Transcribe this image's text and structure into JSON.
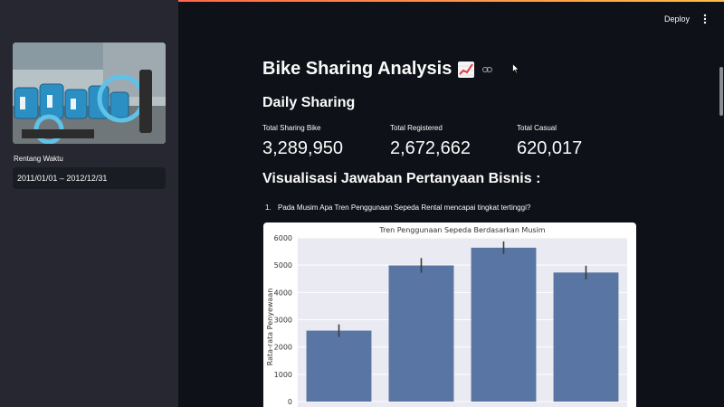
{
  "header": {
    "deploy_label": "Deploy",
    "menu_icon": "more-vertical-icon"
  },
  "sidebar": {
    "image_alt_icon": "bike-share-photo",
    "date_label": "Rentang Waktu",
    "date_range_value": "2011/01/01 – 2012/12/31"
  },
  "main": {
    "title": "Bike Sharing Analysis",
    "title_icon": "chart-increasing-emoji",
    "anchor_icon": "link-icon",
    "daily_heading": "Daily Sharing",
    "metrics": [
      {
        "label": "Total Sharing Bike",
        "value": "3,289,950"
      },
      {
        "label": "Total Registered",
        "value": "2,672,662"
      },
      {
        "label": "Total Casual",
        "value": "620,017"
      }
    ],
    "viz_heading": "Visualisasi Jawaban Pertanyaan Bisnis :",
    "questions": [
      {
        "number": "1.",
        "text": "Pada Musim Apa Tren Penggunaan Sepeda Rental mencapai tingkat tertinggi?"
      }
    ]
  },
  "colors": {
    "app_bg": "#0e1117",
    "sidebar_bg": "#262730",
    "bar": "#5875a4",
    "plot_bg": "#eaeaf2"
  },
  "chart_data": {
    "type": "bar",
    "title": "Tren Penggunaan Sepeda Berdasarkan Musim",
    "xlabel": "",
    "ylabel": "Rata-rata Penyewaan",
    "ylim": [
      0,
      6000
    ],
    "yticks": [
      0,
      1000,
      2000,
      3000,
      4000,
      5000,
      6000
    ],
    "values": [
      2600,
      4990,
      5640,
      4730
    ],
    "errors": [
      230,
      270,
      230,
      250
    ],
    "grid": true
  }
}
